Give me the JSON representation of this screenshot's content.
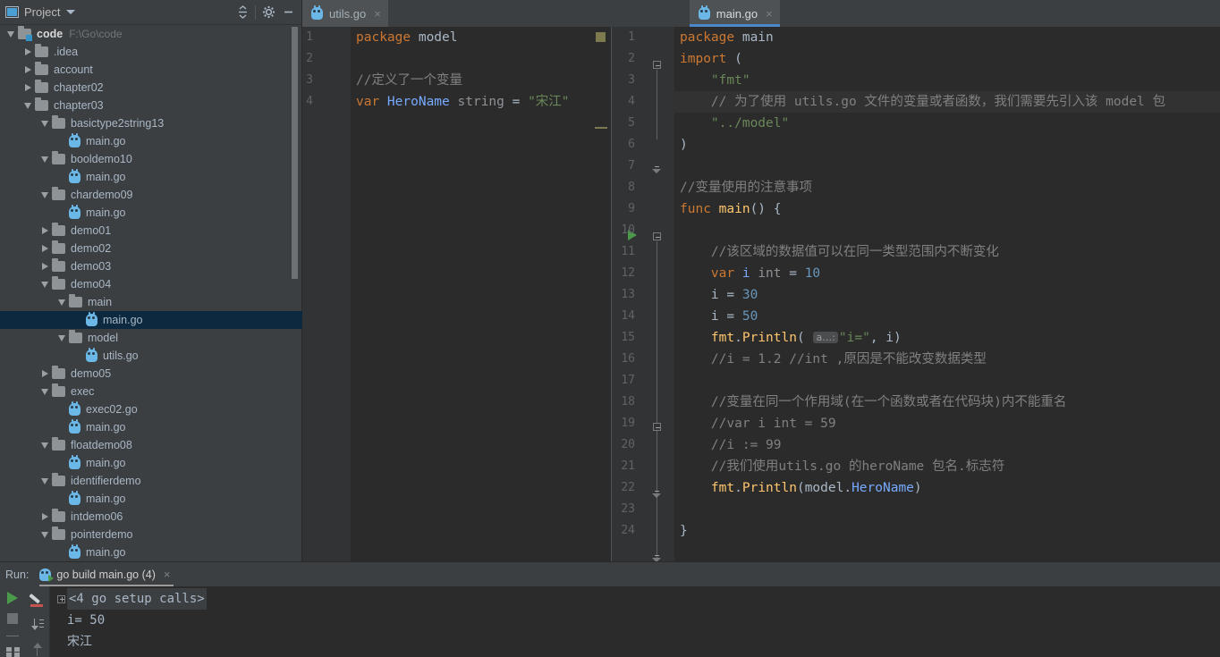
{
  "project_panel": {
    "title": "Project",
    "icons": {
      "window_icon": "project-window-icon",
      "collapse_all": "collapse-all-icon",
      "settings": "gear-icon",
      "minimize": "minimize-icon"
    },
    "tree": [
      {
        "label": "code",
        "path": "F:\\Go\\code",
        "kind": "project-root",
        "twisty": "down",
        "indent": 0,
        "selected": false
      },
      {
        "label": ".idea",
        "kind": "folder",
        "twisty": "right",
        "indent": 1,
        "selected": false
      },
      {
        "label": "account",
        "kind": "folder",
        "twisty": "right",
        "indent": 1,
        "selected": false
      },
      {
        "label": "chapter02",
        "kind": "folder",
        "twisty": "right",
        "indent": 1,
        "selected": false
      },
      {
        "label": "chapter03",
        "kind": "folder",
        "twisty": "down",
        "indent": 1,
        "selected": false
      },
      {
        "label": "basictype2string13",
        "kind": "folder",
        "twisty": "down",
        "indent": 2,
        "selected": false
      },
      {
        "label": "main.go",
        "kind": "go",
        "twisty": "none",
        "indent": 3,
        "selected": false
      },
      {
        "label": "booldemo10",
        "kind": "folder",
        "twisty": "down",
        "indent": 2,
        "selected": false
      },
      {
        "label": "main.go",
        "kind": "go",
        "twisty": "none",
        "indent": 3,
        "selected": false
      },
      {
        "label": "chardemo09",
        "kind": "folder",
        "twisty": "down",
        "indent": 2,
        "selected": false
      },
      {
        "label": "main.go",
        "kind": "go",
        "twisty": "none",
        "indent": 3,
        "selected": false
      },
      {
        "label": "demo01",
        "kind": "folder",
        "twisty": "right",
        "indent": 2,
        "selected": false
      },
      {
        "label": "demo02",
        "kind": "folder",
        "twisty": "right",
        "indent": 2,
        "selected": false
      },
      {
        "label": "demo03",
        "kind": "folder",
        "twisty": "right",
        "indent": 2,
        "selected": false
      },
      {
        "label": "demo04",
        "kind": "folder",
        "twisty": "down",
        "indent": 2,
        "selected": false
      },
      {
        "label": "main",
        "kind": "folder",
        "twisty": "down",
        "indent": 3,
        "selected": false
      },
      {
        "label": "main.go",
        "kind": "go",
        "twisty": "none",
        "indent": 4,
        "selected": true
      },
      {
        "label": "model",
        "kind": "folder",
        "twisty": "down",
        "indent": 3,
        "selected": false
      },
      {
        "label": "utils.go",
        "kind": "go",
        "twisty": "none",
        "indent": 4,
        "selected": false
      },
      {
        "label": "demo05",
        "kind": "folder",
        "twisty": "right",
        "indent": 2,
        "selected": false
      },
      {
        "label": "exec",
        "kind": "folder",
        "twisty": "down",
        "indent": 2,
        "selected": false
      },
      {
        "label": "exec02.go",
        "kind": "go",
        "twisty": "none",
        "indent": 3,
        "selected": false
      },
      {
        "label": "main.go",
        "kind": "go",
        "twisty": "none",
        "indent": 3,
        "selected": false
      },
      {
        "label": "floatdemo08",
        "kind": "folder",
        "twisty": "down",
        "indent": 2,
        "selected": false
      },
      {
        "label": "main.go",
        "kind": "go",
        "twisty": "none",
        "indent": 3,
        "selected": false
      },
      {
        "label": "identifierdemo",
        "kind": "folder",
        "twisty": "down",
        "indent": 2,
        "selected": false
      },
      {
        "label": "main.go",
        "kind": "go",
        "twisty": "none",
        "indent": 3,
        "selected": false
      },
      {
        "label": "intdemo06",
        "kind": "folder",
        "twisty": "right",
        "indent": 2,
        "selected": false
      },
      {
        "label": "pointerdemo",
        "kind": "folder",
        "twisty": "down",
        "indent": 2,
        "selected": false
      },
      {
        "label": "main.go",
        "kind": "go",
        "twisty": "none",
        "indent": 3,
        "selected": false
      }
    ]
  },
  "editor": {
    "tabs": [
      {
        "label": "utils.go",
        "active": false,
        "focused": false,
        "close": "×"
      },
      {
        "label": "main.go",
        "active": true,
        "focused": true,
        "close": "×"
      }
    ],
    "left_pane": {
      "file": "utils.go",
      "lines": [
        {
          "n": "1",
          "current": false,
          "tokens": [
            {
              "t": "package ",
              "c": "kw"
            },
            {
              "t": "model",
              "c": "id"
            }
          ]
        },
        {
          "n": "2",
          "current": false,
          "tokens": []
        },
        {
          "n": "3",
          "current": false,
          "tokens": [
            {
              "t": "//定义了一个变量",
              "c": "cmt"
            }
          ]
        },
        {
          "n": "4",
          "current": false,
          "tokens": [
            {
              "t": "var ",
              "c": "kw"
            },
            {
              "t": "HeroName ",
              "c": "decl"
            },
            {
              "t": "string ",
              "c": "type"
            },
            {
              "t": "= ",
              "c": "id"
            },
            {
              "t": "\"宋江\"",
              "c": "str"
            }
          ]
        }
      ]
    },
    "right_pane": {
      "file": "main.go",
      "lines": [
        {
          "n": "1",
          "current": false,
          "tokens": [
            {
              "t": "package ",
              "c": "kw"
            },
            {
              "t": "main",
              "c": "id"
            }
          ]
        },
        {
          "n": "2",
          "current": false,
          "tokens": [
            {
              "t": "import ",
              "c": "kw"
            },
            {
              "t": "(",
              "c": "id"
            }
          ]
        },
        {
          "n": "3",
          "current": false,
          "tokens": [
            {
              "t": "    \"fmt\"",
              "c": "str"
            }
          ]
        },
        {
          "n": "4",
          "current": true,
          "tokens": [
            {
              "t": "    // 为了使用 utils.go 文件的变量或者函数，我们需要先引入该 model 包",
              "c": "cmt"
            }
          ]
        },
        {
          "n": "5",
          "current": false,
          "tokens": [
            {
              "t": "    \"../model\"",
              "c": "str"
            }
          ]
        },
        {
          "n": "6",
          "current": false,
          "tokens": [
            {
              "t": ")",
              "c": "id"
            }
          ]
        },
        {
          "n": "7",
          "current": false,
          "tokens": []
        },
        {
          "n": "8",
          "current": false,
          "tokens": [
            {
              "t": "//变量使用的注意事项",
              "c": "cmt"
            }
          ]
        },
        {
          "n": "9",
          "current": false,
          "tokens": [
            {
              "t": "func ",
              "c": "kw"
            },
            {
              "t": "main",
              "c": "fn"
            },
            {
              "t": "() {",
              "c": "id"
            }
          ]
        },
        {
          "n": "10",
          "current": false,
          "tokens": []
        },
        {
          "n": "11",
          "current": false,
          "tokens": [
            {
              "t": "    //该区域的数据值可以在同一类型范围内不断变化",
              "c": "cmt"
            }
          ]
        },
        {
          "n": "12",
          "current": false,
          "tokens": [
            {
              "t": "    ",
              "c": "id"
            },
            {
              "t": "var ",
              "c": "kw"
            },
            {
              "t": "i ",
              "c": "decl"
            },
            {
              "t": "int ",
              "c": "type"
            },
            {
              "t": "= ",
              "c": "id"
            },
            {
              "t": "10",
              "c": "num"
            }
          ]
        },
        {
          "n": "13",
          "current": false,
          "tokens": [
            {
              "t": "    i = ",
              "c": "id"
            },
            {
              "t": "30",
              "c": "num"
            }
          ]
        },
        {
          "n": "14",
          "current": false,
          "tokens": [
            {
              "t": "    i = ",
              "c": "id"
            },
            {
              "t": "50",
              "c": "num"
            }
          ]
        },
        {
          "n": "15",
          "current": false,
          "tokens": [
            {
              "t": "    ",
              "c": "id"
            },
            {
              "t": "fmt",
              "c": "fn"
            },
            {
              "t": ".",
              "c": "id"
            },
            {
              "t": "Println",
              "c": "fn"
            },
            {
              "t": "( ",
              "c": "id"
            },
            {
              "t": "a…:",
              "c": "hint"
            },
            {
              "t": "\"i=\"",
              "c": "str"
            },
            {
              "t": ", i)",
              "c": "id"
            }
          ]
        },
        {
          "n": "16",
          "current": false,
          "tokens": [
            {
              "t": "    //i = 1.2 //int ,原因是不能改变数据类型",
              "c": "cmt"
            }
          ]
        },
        {
          "n": "17",
          "current": false,
          "tokens": []
        },
        {
          "n": "18",
          "current": false,
          "tokens": [
            {
              "t": "    //变量在同一个作用域(在一个函数或者在代码块)内不能重名",
              "c": "cmt"
            }
          ]
        },
        {
          "n": "19",
          "current": false,
          "tokens": [
            {
              "t": "    //var i int = 59",
              "c": "cmt"
            }
          ]
        },
        {
          "n": "20",
          "current": false,
          "tokens": [
            {
              "t": "    //i := 99",
              "c": "cmt"
            }
          ]
        },
        {
          "n": "21",
          "current": false,
          "tokens": [
            {
              "t": "    //我们使用utils.go 的heroName 包名.标志符",
              "c": "cmt"
            }
          ]
        },
        {
          "n": "22",
          "current": false,
          "tokens": [
            {
              "t": "    ",
              "c": "id"
            },
            {
              "t": "fmt",
              "c": "fn"
            },
            {
              "t": ".",
              "c": "id"
            },
            {
              "t": "Println",
              "c": "fn"
            },
            {
              "t": "(model.",
              "c": "id"
            },
            {
              "t": "HeroName",
              "c": "decl"
            },
            {
              "t": ")",
              "c": "id"
            }
          ]
        },
        {
          "n": "23",
          "current": false,
          "tokens": []
        },
        {
          "n": "24",
          "current": false,
          "tokens": [
            {
              "t": "}",
              "c": "id"
            }
          ]
        }
      ]
    }
  },
  "run_panel": {
    "label": "Run:",
    "tab_label": "go build main.go (4)",
    "tab_close": "×",
    "console": [
      {
        "text": "<4 go setup calls>",
        "fold": true,
        "style": "setup"
      },
      {
        "text": "i= 50",
        "fold": false,
        "style": "out"
      },
      {
        "text": "宋江",
        "fold": false,
        "style": "out"
      }
    ],
    "side_icons_1": [
      "run-icon",
      "stop-icon",
      "divider",
      "layout-icon"
    ],
    "side_icons_2": [
      "highlight-pen-icon",
      "soft-wrap-icon",
      "scroll-up-icon"
    ]
  },
  "colors": {
    "panel_bg": "#3c3f41",
    "editor_bg": "#2b2b2b",
    "gutter_bg": "#313335",
    "selection": "#0d293f",
    "accent": "#4a88c7",
    "keyword": "#cc7832",
    "string": "#6a8759",
    "number": "#6897bb",
    "comment": "#808080",
    "function": "#ffc66d",
    "declaration": "#77aaff",
    "run_green": "#4a9a4a"
  }
}
